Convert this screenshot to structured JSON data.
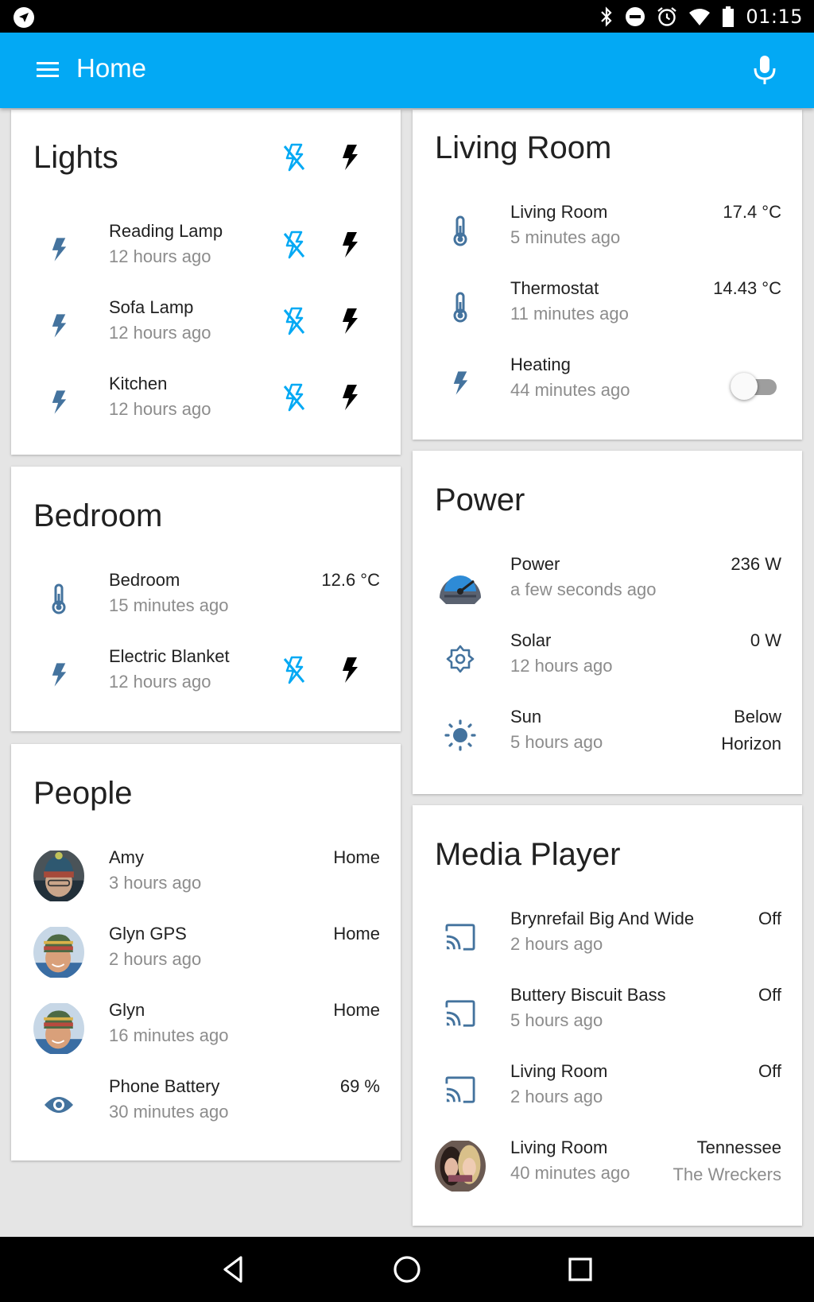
{
  "status_bar": {
    "time": "01:15",
    "icons": [
      "navigation-icon",
      "bluetooth-icon",
      "do-not-disturb-icon",
      "alarm-icon",
      "wifi-icon",
      "battery-icon"
    ]
  },
  "app_bar": {
    "title": "Home",
    "menu_icon": "menu-icon",
    "mic_icon": "microphone-icon",
    "color": "#03a9f4"
  },
  "cards": {
    "lights": {
      "title": "Lights",
      "rows": [
        {
          "name": "Reading Lamp",
          "time": "12 hours ago"
        },
        {
          "name": "Sofa Lamp",
          "time": "12 hours ago"
        },
        {
          "name": "Kitchen",
          "time": "12 hours ago"
        }
      ]
    },
    "bedroom": {
      "title": "Bedroom",
      "rows": [
        {
          "name": "Bedroom",
          "time": "15 minutes ago",
          "value": "12.6 °C"
        },
        {
          "name": "Electric Blanket",
          "time": "12 hours ago"
        }
      ]
    },
    "people": {
      "title": "People",
      "rows": [
        {
          "name": "Amy",
          "time": "3 hours ago",
          "value": "Home"
        },
        {
          "name": "Glyn GPS",
          "time": "2 hours ago",
          "value": "Home"
        },
        {
          "name": "Glyn",
          "time": "16 minutes ago",
          "value": "Home"
        },
        {
          "name": "Phone Battery",
          "time": "30 minutes ago",
          "value": "69 %"
        }
      ]
    },
    "living_room": {
      "title": "Living Room",
      "rows": [
        {
          "name": "Living Room",
          "time": "5 minutes ago",
          "value": "17.4 °C"
        },
        {
          "name": "Thermostat",
          "time": "11 minutes ago",
          "value": "14.43 °C"
        },
        {
          "name": "Heating",
          "time": "44 minutes ago",
          "toggle": "off"
        }
      ]
    },
    "power": {
      "title": "Power",
      "rows": [
        {
          "name": "Power",
          "time": "a few seconds ago",
          "value": "236 W"
        },
        {
          "name": "Solar",
          "time": "12 hours ago",
          "value": "0 W"
        },
        {
          "name": "Sun",
          "time": "5 hours ago",
          "value": "Below",
          "value2": "Horizon"
        }
      ]
    },
    "media_player": {
      "title": "Media Player",
      "rows": [
        {
          "name": "Brynrefail Big And Wide",
          "time": "2 hours ago",
          "value": "Off"
        },
        {
          "name": "Buttery Biscuit Bass",
          "time": "5 hours ago",
          "value": "Off"
        },
        {
          "name": "Living Room",
          "time": "2 hours ago",
          "value": "Off"
        },
        {
          "name": "Living Room",
          "time": "40 minutes ago",
          "value": "Tennessee",
          "value2": "The Wreckers"
        }
      ]
    }
  },
  "colors": {
    "state_icon": "#44739e",
    "off_button": "#03a9f4",
    "on_button": "#000000",
    "secondary_text": "#8c8c8c"
  },
  "nav_bar": {
    "icons": [
      "back-icon",
      "home-icon",
      "recents-icon"
    ]
  }
}
